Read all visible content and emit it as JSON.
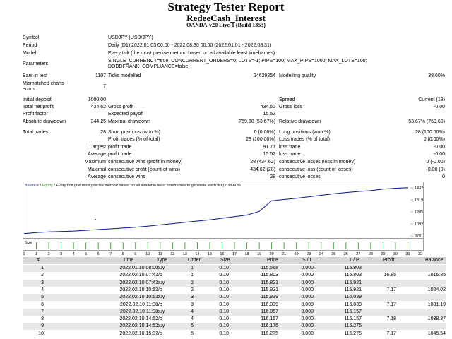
{
  "title": "Strategy Tester Report",
  "subtitle": "RedeeCash_Interest",
  "server": "OANDA-v20 Live-1 (Build 1353)",
  "info": [
    {
      "label": "Symbol",
      "value": "USDJPY (USD/JPY)"
    },
    {
      "label": "Period",
      "value": "Daily (D1) 2022.01.03 00:00 - 2022.08.30 00:00 (2022.01.01 - 2022.08.31)"
    },
    {
      "label": "Model",
      "value": "Every tick (the most precise method based on all available least timeframes)"
    },
    {
      "label": "Parameters",
      "value": "SINGLE_CURRENCY=true; CONCURRENT_ORDERS=0; LOTS=-1; PIPS=100; MAX_PIPS=1000; MAX_LOTS=100;",
      "value2": "DODDFRANK_COMPLIANCE=false;"
    }
  ],
  "bars": {
    "label": "Bars in test",
    "value": "1107",
    "ticks_label": "Ticks modelled",
    "ticks_value": "24629254",
    "quality_label": "Modelling quality",
    "quality_value": "38.60%"
  },
  "mismatched": {
    "label1": "Mismatched charts",
    "label2": "errors",
    "value": "7"
  },
  "stats": {
    "initial_deposit": {
      "label": "Initial deposit",
      "value": "1000.00"
    },
    "spread": {
      "label": "Spread",
      "value": "Current (18)"
    },
    "total_net_profit": {
      "label": "Total net profit",
      "value": "434.62"
    },
    "gross_profit": {
      "label": "Gross profit",
      "value": "434.62"
    },
    "gross_loss": {
      "label": "Gross loss",
      "value": "-0.00"
    },
    "profit_factor": {
      "label": "Profit factor"
    },
    "expected_payoff": {
      "label": "Expected payoff",
      "value": "15.52"
    },
    "absolute_drawdown": {
      "label": "Absolute drawdown",
      "value": "344.25"
    },
    "maximal_drawdown": {
      "label": "Maximal drawdown",
      "value": "759.60 (53.67%)"
    },
    "relative_drawdown": {
      "label": "Relative drawdown",
      "value": "53.67% (759.60)"
    },
    "total_trades": {
      "label": "Total trades",
      "value": "28"
    },
    "short_positions": {
      "label": "Short positions (won %)",
      "value": "0 (0.00%)"
    },
    "long_positions": {
      "label": "Long positions (won %)",
      "value": "28 (100.00%)"
    },
    "profit_trades": {
      "label": "Profit trades (% of total)",
      "value": "28 (100.00%)"
    },
    "loss_trades": {
      "label": "Loss trades (% of total)",
      "value": "0 (0.00%)"
    },
    "largest_label": "Largest",
    "largest_profit": {
      "label": "profit trade",
      "value": "91.71"
    },
    "largest_loss": {
      "label": "loss trade",
      "value": "-0.00"
    },
    "average_label": "Average",
    "average_profit": {
      "label": "profit trade",
      "value": "15.52"
    },
    "average_loss": {
      "label": "loss trade",
      "value": "-0.00"
    },
    "maximum_label": "Maximum",
    "max_cons_wins": {
      "label": "consecutive wins (profit in money)",
      "value": "28 (434.62)"
    },
    "max_cons_losses": {
      "label": "consecutive losses (loss in money)",
      "value": "0 (-0.00)"
    },
    "maximal_label": "Maximal",
    "maximal_cons_profit": {
      "label": "consecutive profit (count of wins)",
      "value": "434.62 (28)"
    },
    "maximal_cons_loss": {
      "label": "consecutive loss (count of losses)",
      "value": "-0.00 (0)"
    },
    "average2_label": "Average",
    "avg_cons_wins": {
      "label": "consecutive wins",
      "value": "28"
    },
    "avg_cons_losses": {
      "label": "consecutive losses",
      "value": "0"
    }
  },
  "chart_data": {
    "type": "line",
    "legend_balance": "Balance",
    "legend_sep1": " / ",
    "legend_equity": "Equity",
    "legend_rest": " / Every tick (the most precise method based on all available least timeframes to generate each tick) / 38.60%",
    "y_ticks": [
      "1432",
      "1319",
      "1205",
      "1092",
      "978"
    ],
    "ylim": [
      978,
      1432
    ],
    "size_label": "Size",
    "x_ticks": [
      "0",
      "1",
      "2",
      "3",
      "4",
      "5",
      "6",
      "7",
      "8",
      "9",
      "10",
      "11",
      "12",
      "13",
      "14",
      "15",
      "16",
      "17",
      "18",
      "19",
      "20",
      "21",
      "22",
      "23",
      "24",
      "25",
      "26",
      "27",
      "28",
      "29",
      "30",
      "31",
      "32"
    ],
    "xlim": [
      0,
      32
    ],
    "balance": [
      [
        0,
        1000
      ],
      [
        1,
        1010
      ],
      [
        2,
        1016
      ],
      [
        3,
        1020
      ],
      [
        4,
        1024
      ],
      [
        5,
        1031
      ],
      [
        6,
        1038
      ],
      [
        7,
        1045
      ],
      [
        8,
        1052
      ],
      [
        9,
        1060
      ],
      [
        10,
        1070
      ],
      [
        11,
        1082
      ],
      [
        12,
        1094
      ],
      [
        13,
        1106
      ],
      [
        14,
        1118
      ],
      [
        15,
        1130
      ],
      [
        16,
        1145
      ],
      [
        17,
        1160
      ],
      [
        18,
        1175
      ],
      [
        19,
        1210
      ],
      [
        20,
        1310
      ],
      [
        21,
        1322
      ],
      [
        22,
        1334
      ],
      [
        23,
        1348
      ],
      [
        24,
        1362
      ],
      [
        25,
        1376
      ],
      [
        26,
        1388
      ],
      [
        27,
        1398
      ],
      [
        28,
        1406
      ],
      [
        29,
        1420
      ],
      [
        30,
        1428
      ],
      [
        31,
        1434
      ]
    ],
    "equity": [
      [
        0,
        1000
      ],
      [
        1,
        1010
      ],
      [
        2,
        1016
      ],
      [
        3,
        1020
      ],
      [
        4,
        1024
      ],
      [
        5,
        1031
      ],
      [
        6,
        1038
      ],
      [
        7,
        1045
      ],
      [
        8,
        1052
      ],
      [
        9,
        1060
      ],
      [
        10,
        1070
      ],
      [
        11,
        1082
      ],
      [
        12,
        1094
      ],
      [
        13,
        1106
      ],
      [
        14,
        1118
      ],
      [
        15,
        1130
      ],
      [
        16,
        1145
      ],
      [
        17,
        1160
      ],
      [
        18,
        1175
      ],
      [
        19,
        1210
      ],
      [
        20,
        1310
      ],
      [
        21,
        1322
      ],
      [
        22,
        1334
      ],
      [
        23,
        1348
      ],
      [
        24,
        1362
      ],
      [
        25,
        1376
      ],
      [
        26,
        1388
      ],
      [
        27,
        1398
      ],
      [
        28,
        1406
      ],
      [
        29,
        1420
      ],
      [
        30,
        1428
      ],
      [
        31,
        1434
      ]
    ],
    "size_bars": [
      1,
      2,
      3,
      4,
      5,
      6,
      7,
      8,
      9,
      10,
      11,
      12,
      13,
      14,
      15,
      16,
      17,
      18,
      19,
      20,
      21,
      22,
      23,
      24,
      25,
      26,
      27,
      28,
      29,
      30,
      31
    ]
  },
  "table": {
    "headers": [
      "#",
      "Time",
      "Type",
      "Order",
      "Size",
      "Price",
      "S / L",
      "T / P",
      "Profit",
      "Balance"
    ],
    "rows": [
      [
        "1",
        "2022.01.10 08:00",
        "buy",
        "1",
        "0.10",
        "115.568",
        "0.000",
        "115.803",
        "",
        ""
      ],
      [
        "2",
        "2022.02.10 07:43",
        "t/p",
        "1",
        "0.10",
        "115.803",
        "0.000",
        "115.803",
        "16.85",
        "1016.85"
      ],
      [
        "3",
        "2022.02.10 07:43",
        "buy",
        "2",
        "0.10",
        "115.821",
        "0.000",
        "115.921",
        "",
        ""
      ],
      [
        "4",
        "2022.02.10 10:53",
        "t/p",
        "2",
        "0.10",
        "115.921",
        "0.000",
        "115.921",
        "7.17",
        "1024.02"
      ],
      [
        "5",
        "2022.02.10 10:53",
        "buy",
        "3",
        "0.10",
        "115.939",
        "0.000",
        "116.039",
        "",
        ""
      ],
      [
        "6",
        "2022.02.10 11:38",
        "t/p",
        "3",
        "0.10",
        "116.039",
        "0.000",
        "116.039",
        "7.17",
        "1031.19"
      ],
      [
        "7",
        "2022.02.10 11:38",
        "buy",
        "4",
        "0.10",
        "116.057",
        "0.000",
        "116.157",
        "",
        ""
      ],
      [
        "8",
        "2022.02.10 14:52",
        "t/p",
        "4",
        "0.10",
        "116.157",
        "0.000",
        "116.157",
        "7.18",
        "1038.37"
      ],
      [
        "9",
        "2022.02.10 14:52",
        "buy",
        "5",
        "0.10",
        "116.175",
        "0.000",
        "116.275",
        "",
        ""
      ],
      [
        "10",
        "2022.02.10 15:37",
        "t/p",
        "5",
        "0.10",
        "116.275",
        "0.000",
        "116.275",
        "7.17",
        "1045.54"
      ]
    ]
  }
}
